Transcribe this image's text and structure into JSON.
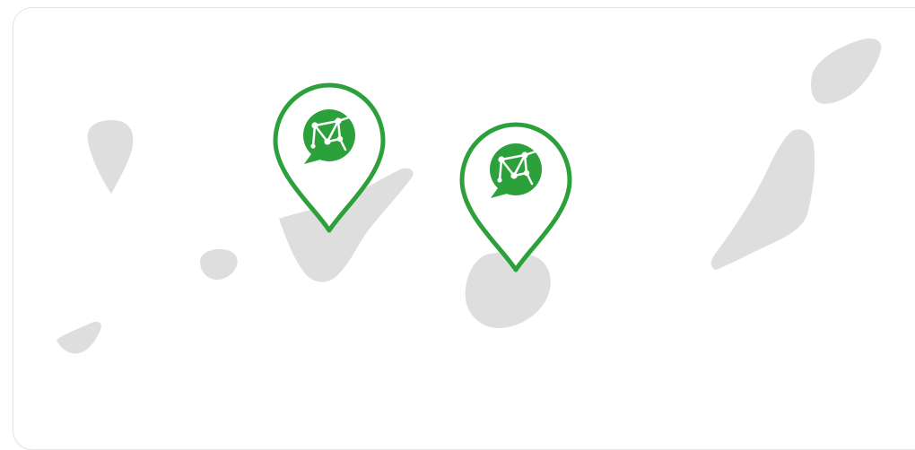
{
  "map": {
    "land_color": "#dedede",
    "background_color": "#ffffff",
    "border_color": "#e4e4e4"
  },
  "markers": {
    "color": "#2ca03a",
    "icon": "chat-network-icon",
    "count": 2
  }
}
